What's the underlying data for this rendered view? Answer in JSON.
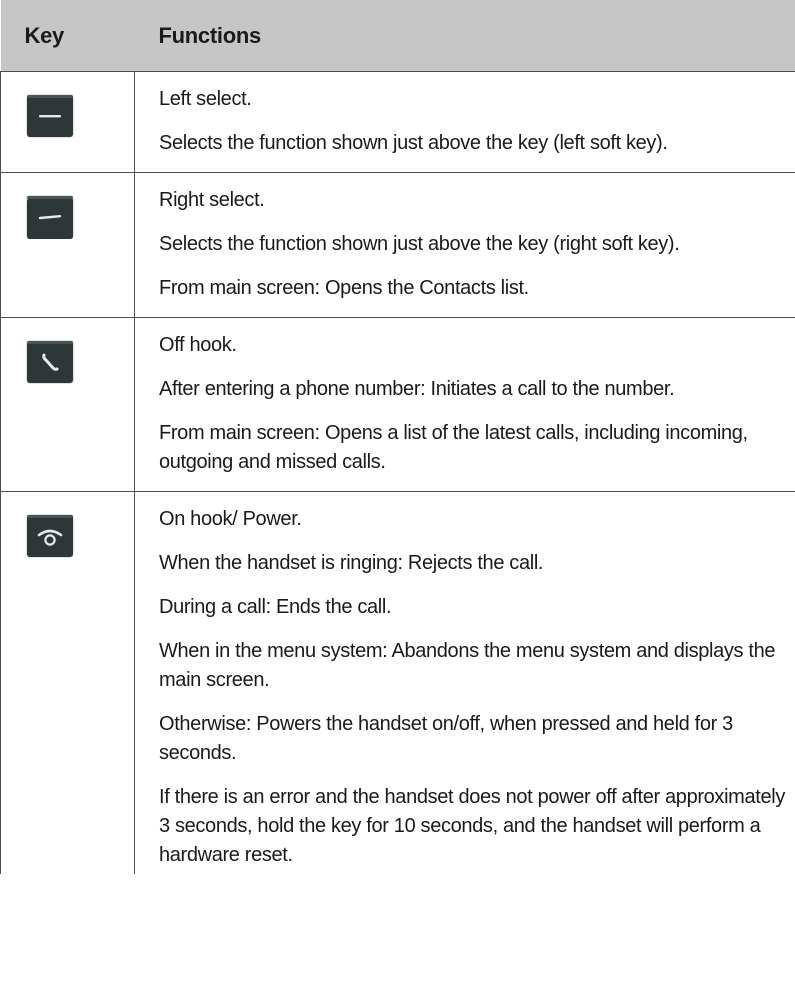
{
  "table": {
    "headers": {
      "key": "Key",
      "functions": "Functions"
    },
    "rows": [
      {
        "key_icon": "left-select-key-icon",
        "functions": [
          "Left select.",
          "Selects the function shown just above the key (left soft key)."
        ]
      },
      {
        "key_icon": "right-select-key-icon",
        "functions": [
          "Right select.",
          "Selects the function shown just above the key (right soft key).",
          "From main screen: Opens the Contacts list."
        ]
      },
      {
        "key_icon": "off-hook-key-icon",
        "functions": [
          "Off hook.",
          "After entering a phone number: Initiates a call to the number.",
          "From main screen: Opens a list of the latest calls, including incoming, outgoing and missed calls."
        ]
      },
      {
        "key_icon": "on-hook-power-key-icon",
        "functions": [
          "On hook/ Power.",
          "When the handset is ringing: Rejects the call.",
          "During a call: Ends the call.",
          "When in the menu system: Abandons the menu system and displays the main screen.",
          "Otherwise: Powers the handset on/off, when pressed and held for 3 seconds.",
          "If there is an error and the handset does not power off after approximately 3 seconds, hold the key for 10 seconds, and the handset will perform a hardware reset."
        ]
      }
    ]
  },
  "colors": {
    "header_background": "#c6c6c6",
    "rule": "#4d4d4d",
    "keycap_face": "#2f3638",
    "keycap_highlight": "#e8eaea"
  }
}
